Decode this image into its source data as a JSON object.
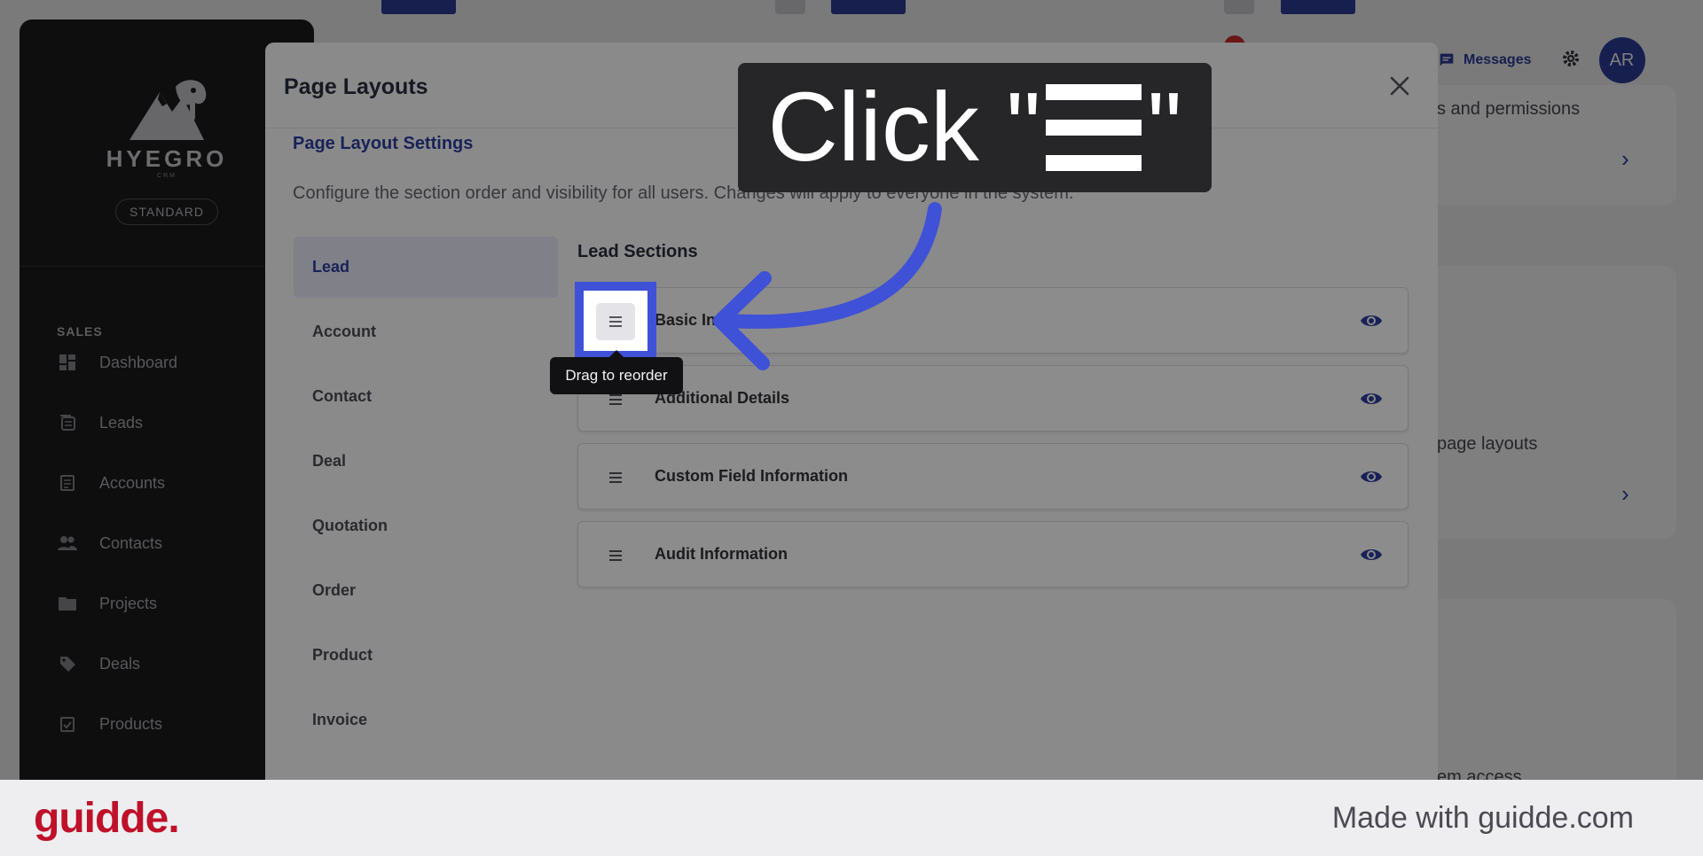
{
  "app": {
    "brand": "HYEGRO",
    "brand_sub": "CRM",
    "plan": "STANDARD",
    "sidebar_section": "SALES",
    "nav": [
      {
        "label": "Dashboard",
        "icon": "dashboard-icon"
      },
      {
        "label": "Leads",
        "icon": "leads-icon"
      },
      {
        "label": "Accounts",
        "icon": "accounts-icon"
      },
      {
        "label": "Contacts",
        "icon": "contacts-icon"
      },
      {
        "label": "Projects",
        "icon": "folder-icon"
      },
      {
        "label": "Deals",
        "icon": "tag-icon"
      },
      {
        "label": "Products",
        "icon": "products-icon"
      }
    ],
    "header": {
      "messages_label": "Messages",
      "avatar_initials": "AR"
    },
    "bg_snippets": {
      "roles_text": "s and permissions",
      "layouts_text": "page layouts",
      "partial_heading": "s",
      "partial_text": "em access"
    }
  },
  "modal": {
    "title": "Page Layouts",
    "settings_title": "Page Layout Settings",
    "description": "Configure the section order and visibility for all users. Changes will apply to everyone in the system.",
    "tabs": [
      {
        "label": "Lead",
        "active": true
      },
      {
        "label": "Account",
        "active": false
      },
      {
        "label": "Contact",
        "active": false
      },
      {
        "label": "Deal",
        "active": false
      },
      {
        "label": "Quotation",
        "active": false
      },
      {
        "label": "Order",
        "active": false
      },
      {
        "label": "Product",
        "active": false
      },
      {
        "label": "Invoice",
        "active": false
      }
    ],
    "sections_title": "Lead Sections",
    "sections": [
      {
        "label": "Basic In",
        "visible": true
      },
      {
        "label": "Additional Details",
        "visible": true
      },
      {
        "label": "Custom Field Information",
        "visible": true
      },
      {
        "label": "Audit Information",
        "visible": true
      }
    ]
  },
  "annotation": {
    "callout_prefix": "Click \"",
    "callout_glyph": "☰",
    "callout_suffix": "\"",
    "tooltip": "Drag to reorder",
    "accent_color": "#3f51d6"
  },
  "footer": {
    "logo": "guidde.",
    "made_with": "Made with guidde.com"
  }
}
